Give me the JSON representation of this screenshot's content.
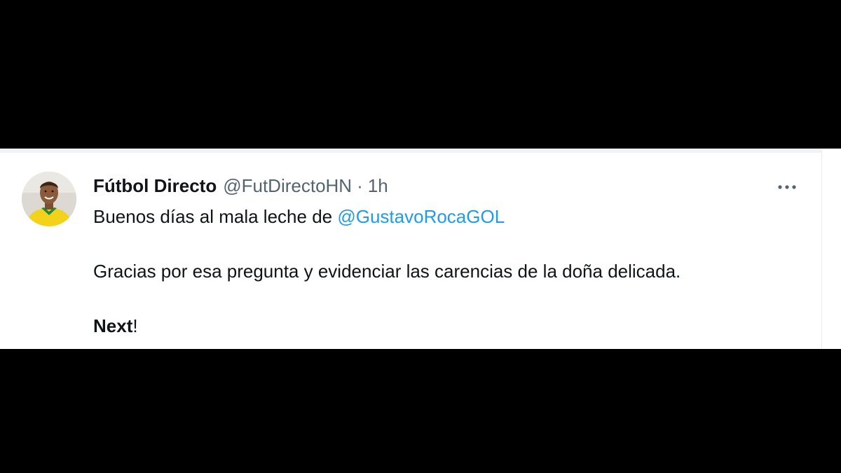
{
  "tweet": {
    "author": {
      "display_name": "Fútbol Directo",
      "handle": "@FutDirectoHN",
      "separator": "·",
      "timestamp": "1h"
    },
    "body": {
      "line1_prefix": "Buenos días al mala leche de ",
      "line1_mention": "@GustavoRocaGOL",
      "line2": "Gracias por esa pregunta y evidenciar las carencias de la doña delicada.",
      "line3_bold": "Next",
      "line3_suffix": "!"
    },
    "icons": {
      "more": "more-horizontal-icon",
      "avatar": "profile-photo"
    },
    "colors": {
      "background": "#000000",
      "card": "#ffffff",
      "text": "#0f1419",
      "secondary_text": "#536471",
      "mention": "#1d9bf0",
      "avatar_shirt": "#f2d21a",
      "avatar_collar": "#1e8a3c"
    }
  }
}
